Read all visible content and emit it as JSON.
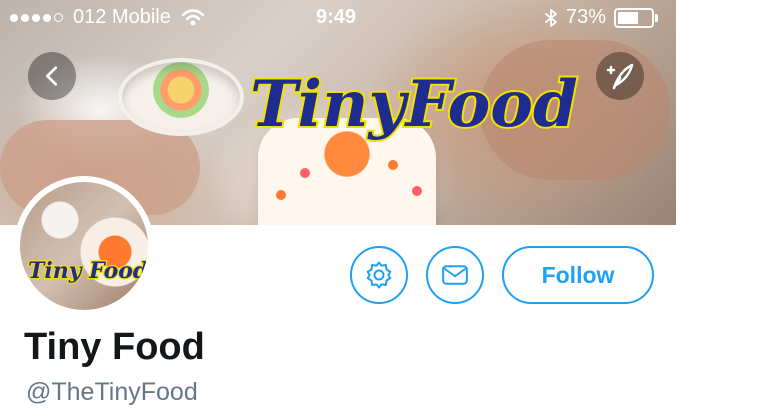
{
  "status_bar": {
    "carrier": "012 Mobile",
    "time": "9:49",
    "battery_percent": "73%",
    "battery_level": 0.73,
    "signal_dots_filled": 4,
    "signal_dots_total": 5,
    "wifi_icon": "wifi-icon",
    "bluetooth_icon": "bluetooth-icon"
  },
  "banner": {
    "logo_text": "TinyFood"
  },
  "avatar": {
    "logo_text": "Tiny Food"
  },
  "actions": {
    "settings_icon": "gear-icon",
    "message_icon": "envelope-icon",
    "follow_label": "Follow"
  },
  "profile": {
    "display_name": "Tiny Food",
    "handle": "@TheTinyFood"
  },
  "colors": {
    "accent": "#1da1f2",
    "name_text": "#14171a",
    "handle_text": "#657786",
    "logo_fill": "#1f2c8f",
    "logo_outline": "#f3e100"
  }
}
